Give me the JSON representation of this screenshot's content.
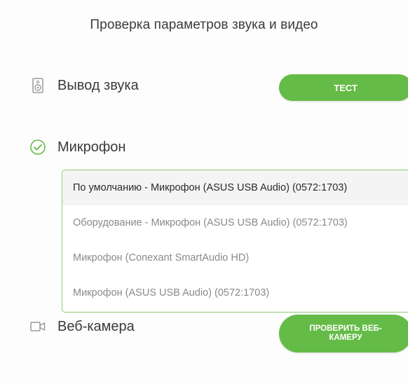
{
  "header": {
    "title": "Проверка параметров звука и видео"
  },
  "audio_output": {
    "label": "Вывод звука",
    "icon": "speaker-icon",
    "test_button_label": "ТЕСТ"
  },
  "microphone": {
    "label": "Микрофон",
    "icon": "check-circle-icon",
    "status": "verified",
    "options": [
      {
        "label": "По умолчанию - Микрофон (ASUS USB Audio) (0572:1703)",
        "selected": true
      },
      {
        "label": "Оборудование - Микрофон (ASUS USB Audio) (0572:1703)",
        "selected": false
      },
      {
        "label": "Микрофон (Conexant SmartAudio HD)",
        "selected": false
      },
      {
        "label": "Микрофон (ASUS USB Audio) (0572:1703)",
        "selected": false
      }
    ]
  },
  "webcam": {
    "label": "Веб-камера",
    "icon": "camera-icon",
    "check_button_label": "ПРОВЕРИТЬ ВЕБ-КАМЕРУ"
  },
  "colors": {
    "accent_green": "#65bb47",
    "border_green": "#8ccd74",
    "icon_gray": "#9a9a9a",
    "text_dark": "#3a3a3a",
    "text_muted": "#8a8a8a"
  }
}
